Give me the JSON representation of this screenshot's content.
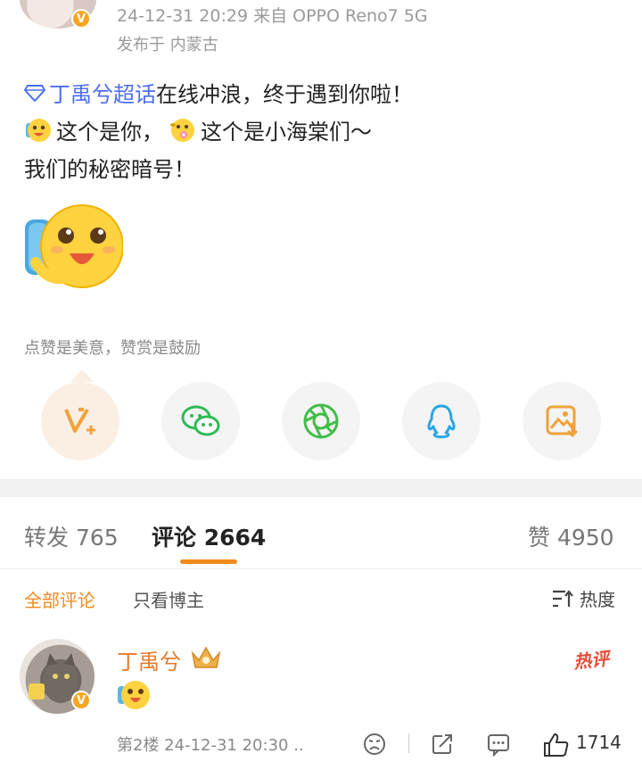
{
  "post": {
    "meta_time_device": "24-12-31 20:29  来自 OPPO Reno7 5G",
    "meta_location": "发布于 内蒙古",
    "topic": "丁禹兮超话",
    "line1_rest": " 在线冲浪，终于遇到你啦！",
    "line2_a": "这个是你，",
    "line2_b": "这个是小海棠们～",
    "line3": "我们的秘密暗号！",
    "reward_text": "点赞是美意，赞赏是鼓励"
  },
  "share": {
    "items": [
      "reward-vplus-icon",
      "wechat-icon",
      "moments-icon",
      "qq-icon",
      "save-image-icon"
    ]
  },
  "tabs": {
    "repost": "转发 765",
    "comments": "评论 2664",
    "likes": "赞 4950"
  },
  "filters": {
    "all": "全部评论",
    "op_only": "只看博主",
    "sort": "热度"
  },
  "comment": {
    "name": "丁禹兮",
    "hot_badge": "热评",
    "footer": "第2楼 24-12-31 20:30 ..",
    "like_count": "1714"
  },
  "colors": {
    "accent_orange": "#f28b1d",
    "topic_blue": "#4e6ef2",
    "hot_red": "#e24e3a",
    "verified_gold": "#f6a623"
  }
}
